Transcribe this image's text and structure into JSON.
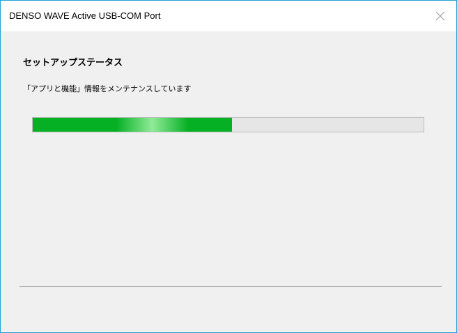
{
  "window": {
    "title": "DENSO WAVE Active USB-COM Port",
    "close_icon": "close-icon"
  },
  "main": {
    "heading": "セットアップステータス",
    "status": "「アプリと機能」情報をメンテナンスしています",
    "progress": 0.51
  },
  "colors": {
    "window_border": "#1fa1d8",
    "progress_fill": "#06b025",
    "progress_track": "#e6e6e6"
  }
}
